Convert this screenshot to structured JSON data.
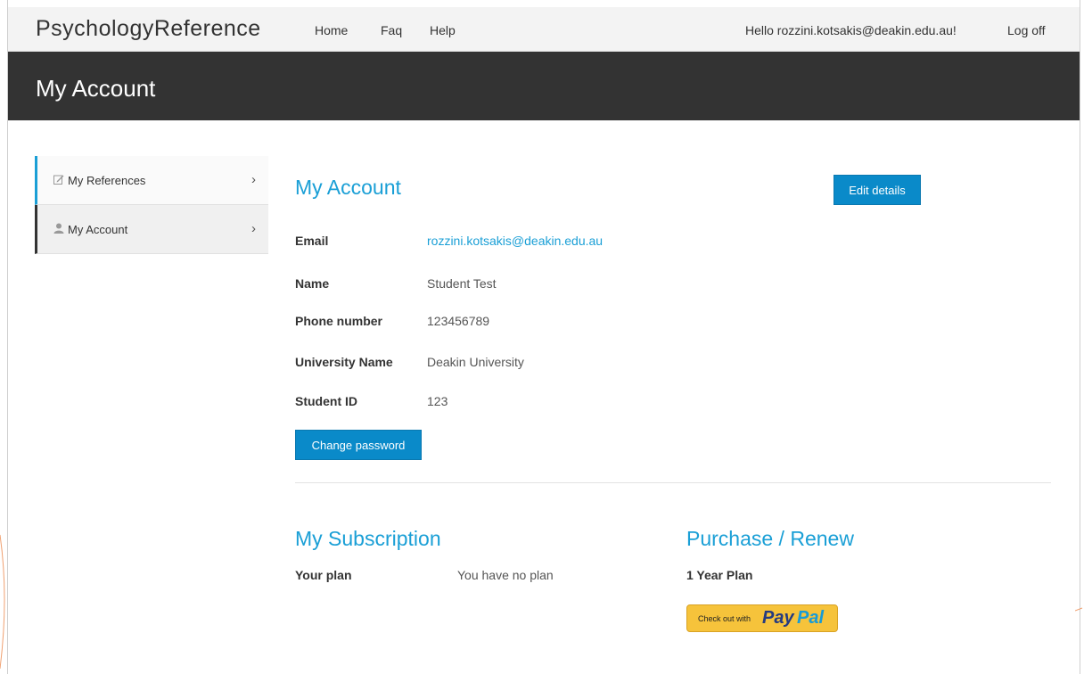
{
  "navbar": {
    "brand": "PsychologyReference",
    "links": [
      "Home",
      "Faq",
      "Help"
    ],
    "greeting": "Hello rozzini.kotsakis@deakin.edu.au!",
    "logoff": "Log off"
  },
  "hero": {
    "title": "My Account"
  },
  "sidebar": {
    "items": [
      {
        "label": "My References",
        "icon": "edit-icon"
      },
      {
        "label": "My Account",
        "icon": "user-icon"
      }
    ]
  },
  "account": {
    "title": "My Account",
    "edit_button": "Edit details",
    "fields": [
      {
        "label": "Email",
        "value": "rozzini.kotsakis@deakin.edu.au"
      },
      {
        "label": "Name",
        "value": "Student Test"
      },
      {
        "label": "Phone number",
        "value": "123456789"
      },
      {
        "label": "University Name",
        "value": "Deakin University"
      },
      {
        "label": "Student ID",
        "value": "123"
      }
    ],
    "change_password": "Change password"
  },
  "subscription": {
    "title": "My Subscription",
    "plan_label": "Your plan",
    "plan_value": "You have no plan"
  },
  "purchase": {
    "title": "Purchase / Renew",
    "plan": "1 Year Plan",
    "paypal": {
      "check": "Check out with",
      "pay": "Pay",
      "pal": "Pal"
    }
  },
  "colors": {
    "accent": "#1a9fd6",
    "button": "#0a8ac9",
    "hero": "#333333",
    "paypal": "#f6c33b"
  }
}
